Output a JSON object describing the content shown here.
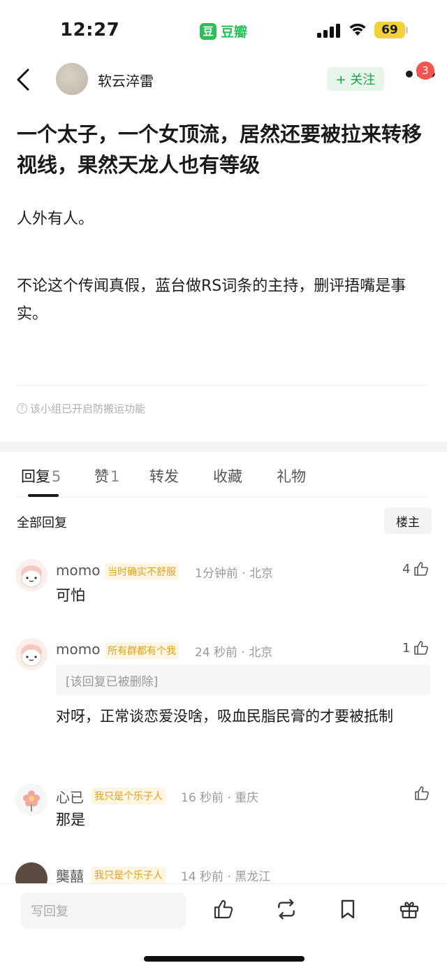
{
  "status_bar": {
    "time": "12:27",
    "app_logo": "豆",
    "app_name": "豆瓣",
    "battery": "69"
  },
  "nav": {
    "author": "软云淬雷",
    "follow_label": "+ 关注",
    "more_badge": "3"
  },
  "post": {
    "title": "一个太子，一个女顶流，居然还要被拉来转移视线，果然天龙人也有等级",
    "paragraphs": [
      "人外有人。",
      "不论这个传闻真假，蓝台做RS词条的主持，删评捂嘴是事实。"
    ],
    "notice": "该小组已开启防搬运功能"
  },
  "tabs": [
    {
      "label": "回复",
      "count": "5"
    },
    {
      "label": "赞",
      "count": "1"
    },
    {
      "label": "转发",
      "count": ""
    },
    {
      "label": "收藏",
      "count": ""
    },
    {
      "label": "礼物",
      "count": ""
    }
  ],
  "replies_header": {
    "all": "全部回复",
    "op_only": "楼主"
  },
  "comments": [
    {
      "name": "momo",
      "tag": "当时确实不舒服",
      "meta": "1分钟前 · 北京",
      "likes": "4",
      "text": "可怕"
    },
    {
      "name": "momo",
      "tag": "所有群都有个我",
      "meta": "24 秒前 · 北京",
      "likes": "1",
      "quoted": "[该回复已被删除]",
      "text": "对呀，正常谈恋爱没啥，吸血民脂民膏的才要被抵制"
    },
    {
      "name": "心已",
      "tag": "我只是个乐子人",
      "meta": "16 秒前 · 重庆",
      "likes": "",
      "text": "那是"
    },
    {
      "name": "龑囍",
      "tag": "我只是个乐子人",
      "meta": "14 秒前 · 黑龙江",
      "likes": "",
      "text": ""
    }
  ],
  "bottom_bar": {
    "reply_placeholder": "写回复",
    "icons": [
      "like-icon",
      "repost-icon",
      "bookmark-icon",
      "gift-icon"
    ]
  },
  "colors": {
    "brand_green": "#2dbe5a",
    "tag_orange": "#e0a020",
    "badge_red": "#f25450"
  }
}
